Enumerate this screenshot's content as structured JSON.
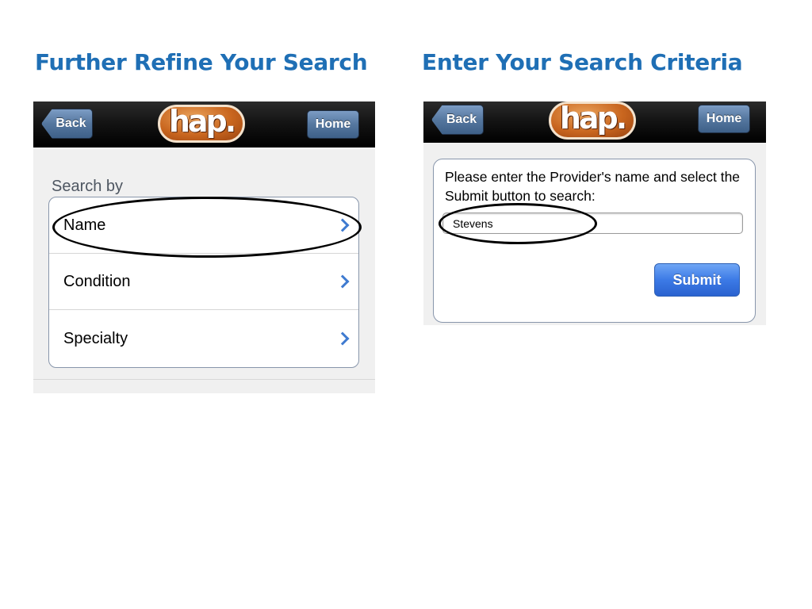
{
  "slide": {
    "left_title": "Further Refine Your Search",
    "right_title": "Enter Your Search Criteria"
  },
  "left_screen": {
    "navbar": {
      "back_label": "Back",
      "home_label": "Home",
      "logo_text": "hap."
    },
    "search_by_label": "Search by",
    "items": [
      {
        "label": "Name"
      },
      {
        "label": "Condition"
      },
      {
        "label": "Specialty"
      }
    ]
  },
  "right_screen": {
    "navbar": {
      "back_label": "Back",
      "home_label": "Home",
      "logo_text": "hap."
    },
    "instruction": "Please enter the Provider's name and select the Submit button to search:",
    "provider_input_value": "Stevens",
    "submit_label": "Submit"
  },
  "colors": {
    "title": "#1f6fb5",
    "nav_button": "#55779f",
    "logo": "#c9661f",
    "chevron": "#3f7bd0",
    "submit": "#3c7ae6"
  },
  "icons": {
    "chevron": "chevron-right-icon",
    "back": "back-arrow-button"
  }
}
